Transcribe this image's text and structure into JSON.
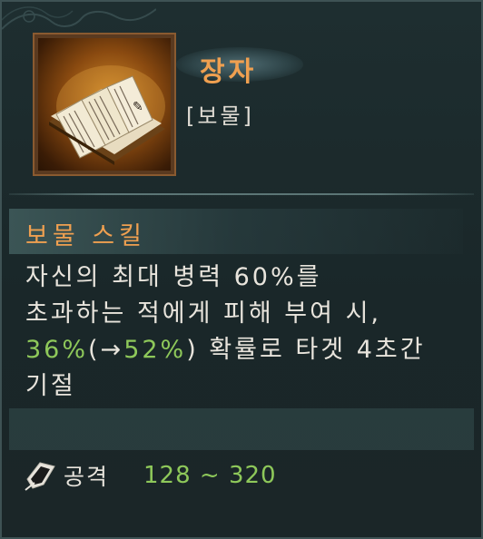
{
  "item": {
    "name": "장자",
    "type": "[보물]",
    "icon": "book-scroll-icon"
  },
  "skill": {
    "header": "보물 스킬",
    "lines": {
      "l1": "자신의 최대 병력 60%를",
      "l2": "초과하는 적에게 피해 부여 시,",
      "l3_value": "36%",
      "l3_upgrade": "(→52%)",
      "l3_rest": " 확률로 타겟 4초간",
      "l4": "기절"
    }
  },
  "stat": {
    "icon": "quill-attack-icon",
    "label": "공격",
    "value": "128 ~ 320"
  },
  "colors": {
    "accent": "#f0a050",
    "value_green": "#8ec85a",
    "background": "#1c2a2c"
  }
}
